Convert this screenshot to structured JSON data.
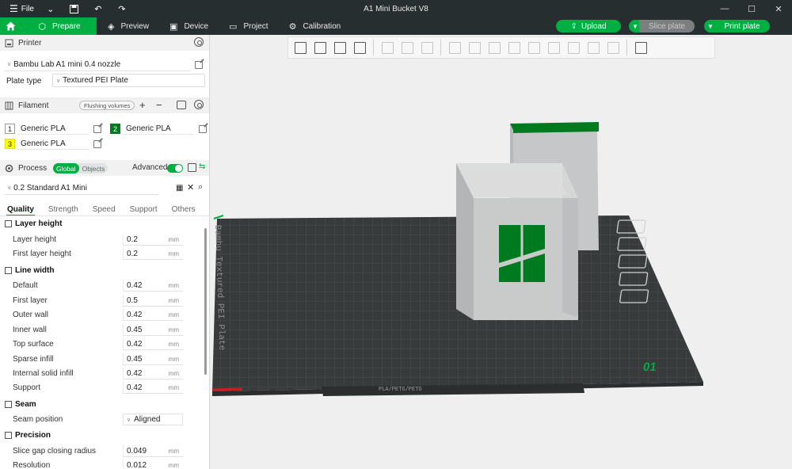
{
  "window": {
    "title": "A1 Mini Bucket V8",
    "file_label": "File"
  },
  "nav": {
    "tabs": [
      {
        "label": "Prepare",
        "icon": "cube-icon"
      },
      {
        "label": "Preview",
        "icon": "layers-icon"
      },
      {
        "label": "Device",
        "icon": "device-icon"
      },
      {
        "label": "Project",
        "icon": "folder-icon"
      },
      {
        "label": "Calibration",
        "icon": "calibration-icon"
      }
    ],
    "upload_label": "Upload",
    "slice_label": "Slice plate",
    "print_label": "Print plate"
  },
  "printer": {
    "header": "Printer",
    "model": "Bambu Lab A1 mini 0.4 nozzle",
    "plate_type_label": "Plate type",
    "plate_type": "Textured PEI Plate"
  },
  "filament": {
    "header": "Filament",
    "flushing_label": "Flushing volumes",
    "slots": [
      {
        "num": "1",
        "name": "Generic PLA",
        "color": "#ffffff"
      },
      {
        "num": "2",
        "name": "Generic PLA",
        "color": "#007a1f"
      },
      {
        "num": "3",
        "name": "Generic PLA",
        "color": "#ffff00"
      }
    ]
  },
  "process": {
    "header": "Process",
    "global_label": "Global",
    "objects_label": "Objects",
    "advanced_label": "Advanced",
    "preset": "0.2 Standard A1 Mini",
    "tabs": [
      "Quality",
      "Strength",
      "Speed",
      "Support",
      "Others"
    ],
    "groups": [
      {
        "title": "Layer height",
        "params": [
          {
            "label": "Layer height",
            "value": "0.2",
            "unit": "mm"
          },
          {
            "label": "First layer height",
            "value": "0.2",
            "unit": "mm"
          }
        ]
      },
      {
        "title": "Line width",
        "params": [
          {
            "label": "Default",
            "value": "0.42",
            "unit": "mm"
          },
          {
            "label": "First layer",
            "value": "0.5",
            "unit": "mm"
          },
          {
            "label": "Outer wall",
            "value": "0.42",
            "unit": "mm"
          },
          {
            "label": "Inner wall",
            "value": "0.45",
            "unit": "mm"
          },
          {
            "label": "Top surface",
            "value": "0.42",
            "unit": "mm"
          },
          {
            "label": "Sparse infill",
            "value": "0.45",
            "unit": "mm"
          },
          {
            "label": "Internal solid infill",
            "value": "0.42",
            "unit": "mm"
          },
          {
            "label": "Support",
            "value": "0.42",
            "unit": "mm"
          }
        ]
      },
      {
        "title": "Seam",
        "params": [
          {
            "label": "Seam position",
            "value": "Aligned",
            "unit": ""
          }
        ]
      },
      {
        "title": "Precision",
        "params": [
          {
            "label": "Slice gap closing radius",
            "value": "0.049",
            "unit": "mm"
          },
          {
            "label": "Resolution",
            "value": "0.012",
            "unit": "mm"
          }
        ]
      }
    ]
  },
  "plate": {
    "number": "01",
    "bed_text": "Bambu Textured PEI Plate",
    "bottom_label": "PLA/PETG/PETG",
    "accent": "#00ae42"
  }
}
